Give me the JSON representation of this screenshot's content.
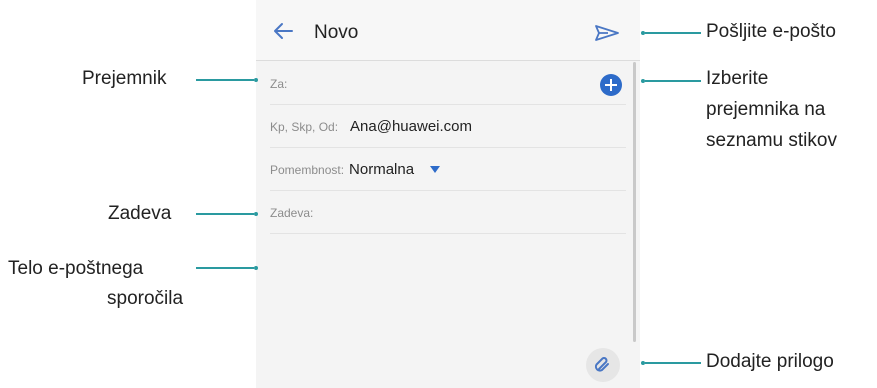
{
  "header": {
    "title": "Novo",
    "back_icon": "arrow-left-icon",
    "send_icon": "send-icon"
  },
  "form": {
    "to_label": "Za:",
    "cc_label": "Kp, Skp, Od:",
    "cc_value": "Ana@huawei.com",
    "priority_label": "Pomembnost:",
    "priority_value": "Normalna",
    "subject_label": "Zadeva:",
    "add_recipient_icon": "plus-circle-icon",
    "attach_icon": "paperclip-icon"
  },
  "callouts": {
    "recipient": "Prejemnik",
    "subject": "Zadeva",
    "body_line1": "Telo e-poštnega",
    "body_line2": "sporočila",
    "send": "Pošljite e-pošto",
    "choose_line1": "Izberite",
    "choose_line2": "prejemnika na",
    "choose_line3": "seznamu stikov",
    "attach": "Dodajte prilogo"
  },
  "colors": {
    "accent": "#2d6bc9",
    "callout_line": "#2a9aa0",
    "icon_blue": "#4a77c4"
  }
}
